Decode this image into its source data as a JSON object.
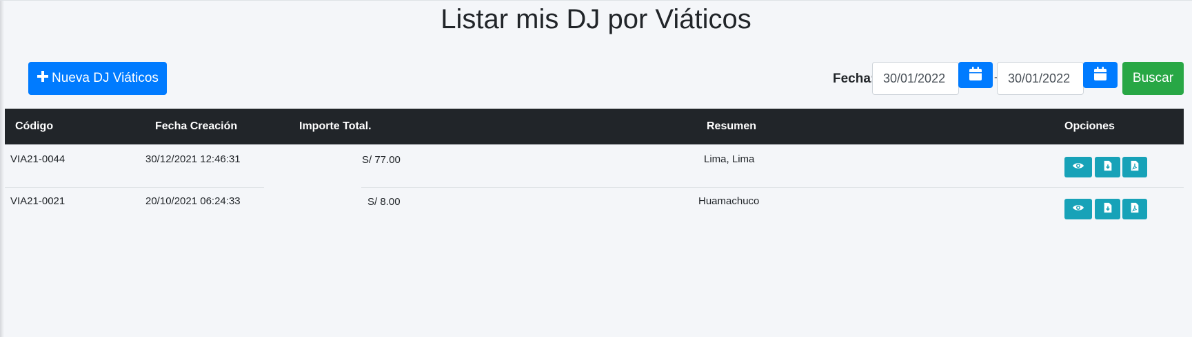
{
  "page": {
    "title": "Listar mis DJ por Viáticos"
  },
  "toolbar": {
    "new_button_label": "Nueva DJ Viáticos",
    "date_label": "Fecha:",
    "date_from": "30/01/2022",
    "date_separator": "-",
    "date_to": "30/01/2022",
    "search_label": "Buscar"
  },
  "table": {
    "headers": [
      "Código",
      "Fecha Creación",
      "Importe Total.",
      "Resumen",
      "Opciones"
    ],
    "rows": [
      {
        "codigo": "VIA21-0044",
        "fecha": "30/12/2021 12:46:31",
        "importe": "S/ 77.00",
        "resumen": "Lima, Lima"
      },
      {
        "codigo": "VIA21-0021",
        "fecha": "20/10/2021 06:24:33",
        "importe": "S/ 8.00",
        "resumen": "Huamachuco"
      }
    ]
  },
  "icons": {
    "new": "plus-icon",
    "calendar": "calendar-icon",
    "view": "eye-icon",
    "download": "file-download-icon",
    "pdf": "file-pdf-icon"
  },
  "colors": {
    "primary": "#007bff",
    "success": "#28a745",
    "info": "#17a2b8",
    "header_bg": "#212529"
  }
}
